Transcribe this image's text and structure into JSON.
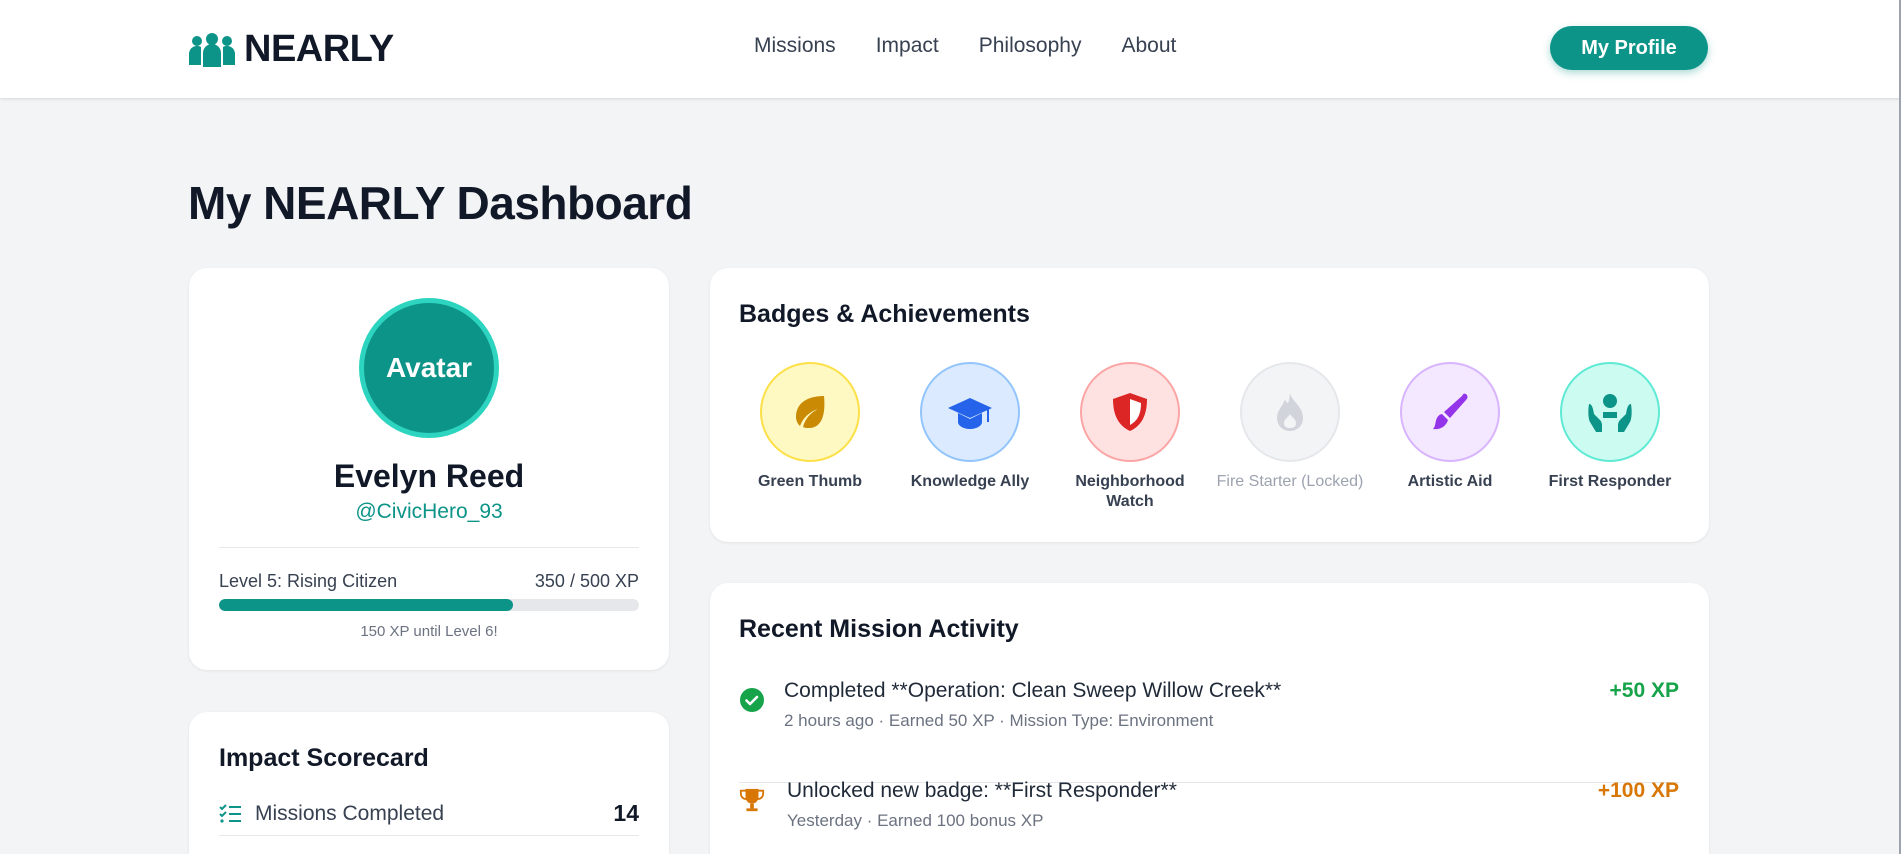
{
  "header": {
    "logo_text": "NEARLY",
    "nav": [
      "Missions",
      "Impact",
      "Philosophy",
      "About"
    ],
    "profile_button": "My Profile"
  },
  "page": {
    "title": "My NEARLY Dashboard"
  },
  "profile": {
    "avatar_text": "Avatar",
    "name": "Evelyn Reed",
    "handle": "@CivicHero_93",
    "level_label": "Level 5: Rising Citizen",
    "xp_label": "350 / 500 XP",
    "xp_current": 350,
    "xp_max": 500,
    "until_next": "150 XP until Level 6!"
  },
  "scorecard": {
    "title": "Impact Scorecard",
    "rows": [
      {
        "icon": "task-list-icon",
        "label": "Missions Completed",
        "value": "14"
      }
    ]
  },
  "badges": {
    "title": "Badges & Achievements",
    "items": [
      {
        "label": "Green Thumb",
        "icon": "leaf-icon",
        "locked": false,
        "bg": "#fef9c3",
        "border": "#fde047",
        "color": "#ca8a04"
      },
      {
        "label": "Knowledge Ally",
        "icon": "graduation-cap-icon",
        "locked": false,
        "bg": "#dbeafe",
        "border": "#93c5fd",
        "color": "#2563eb"
      },
      {
        "label": "Neighborhood Watch",
        "icon": "shield-icon",
        "locked": false,
        "bg": "#fee2e2",
        "border": "#fca5a5",
        "color": "#dc2626"
      },
      {
        "label": "Fire Starter (Locked)",
        "icon": "flame-icon",
        "locked": true,
        "bg": "#f3f4f6",
        "border": "#e5e7eb",
        "color": "#d1d5db"
      },
      {
        "label": "Artistic Aid",
        "icon": "paintbrush-icon",
        "locked": false,
        "bg": "#f3e8ff",
        "border": "#d8b4fe",
        "color": "#9333ea"
      },
      {
        "label": "First Responder",
        "icon": "hands-holding-person-icon",
        "locked": false,
        "bg": "#ccfbf1",
        "border": "#5eead4",
        "color": "#0d9488"
      }
    ]
  },
  "activity": {
    "title": "Recent Mission Activity",
    "items": [
      {
        "icon": "check-circle-icon",
        "title": "Completed **Operation: Clean Sweep Willow Creek**",
        "meta": "2 hours ago · Earned 50 XP · Mission Type: Environment",
        "xp": "+50 XP",
        "xp_color": "#16a34a"
      },
      {
        "icon": "trophy-icon",
        "title": "Unlocked new badge: **First Responder**",
        "meta": "Yesterday · Earned 100 bonus XP",
        "xp": "+100 XP",
        "xp_color": "#d97706"
      }
    ]
  },
  "colors": {
    "brand": "#0d9488",
    "background": "#f3f4f6"
  }
}
